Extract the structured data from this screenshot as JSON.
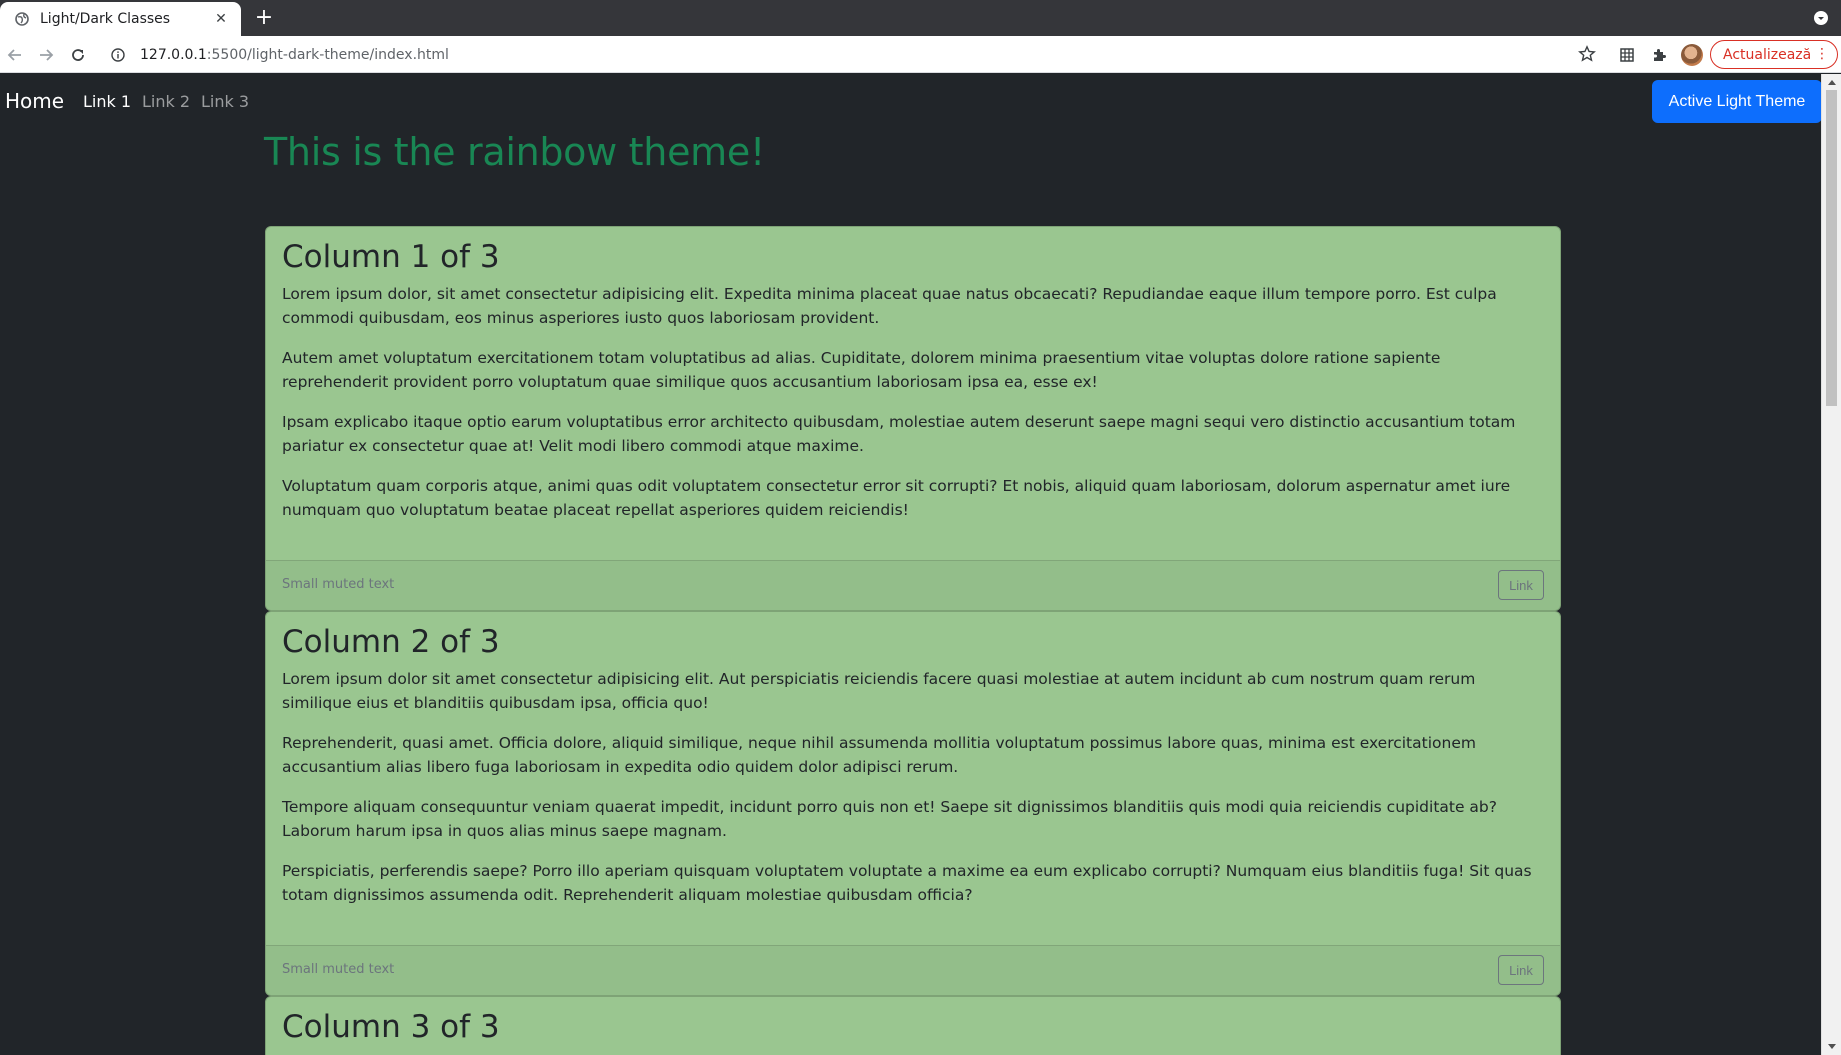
{
  "browser": {
    "tab_title": "Light/Dark Classes",
    "tab_close": "✕",
    "new_tab": "+",
    "url_host": "127.0.0.1",
    "url_rest": ":5500/light-dark-theme/index.html",
    "update_label": "Actualizează",
    "menu_dots": "⋮"
  },
  "navbar": {
    "brand": "Home",
    "links": [
      "Link 1",
      "Link 2",
      "Link 3"
    ],
    "active_link": "Link 1",
    "theme_button": "Active Light Theme"
  },
  "hero": {
    "title": "This is the rainbow theme!"
  },
  "cards": [
    {
      "title": "Column 1 of 3",
      "paragraphs": [
        "Lorem ipsum dolor, sit amet consectetur adipisicing elit. Expedita minima placeat quae natus obcaecati? Repudiandae eaque illum tempore porro. Est culpa commodi quibusdam, eos minus asperiores iusto quos laboriosam provident.",
        "Autem amet voluptatum exercitationem totam voluptatibus ad alias. Cupiditate, dolorem minima praesentium vitae voluptas dolore ratione sapiente reprehenderit provident porro voluptatum quae similique quos accusantium laboriosam ipsa ea, esse ex!",
        "Ipsam explicabo itaque optio earum voluptatibus error architecto quibusdam, molestiae autem deserunt saepe magni sequi vero distinctio accusantium totam pariatur ex consectetur quae at! Velit modi libero commodi atque maxime.",
        "Voluptatum quam corporis atque, animi quas odit voluptatem consectetur error sit corrupti? Et nobis, aliquid quam laboriosam, dolorum aspernatur amet iure numquam quo voluptatum beatae placeat repellat asperiores quidem reiciendis!"
      ],
      "footer_text": "Small muted text",
      "footer_link": "Link"
    },
    {
      "title": "Column 2 of 3",
      "paragraphs": [
        "Lorem ipsum dolor sit amet consectetur adipisicing elit. Aut perspiciatis reiciendis facere quasi molestiae at autem incidunt ab cum nostrum quam rerum similique eius et blanditiis quibusdam ipsa, officia quo!",
        "Reprehenderit, quasi amet. Officia dolore, aliquid similique, neque nihil assumenda mollitia voluptatum possimus labore quas, minima est exercitationem accusantium alias libero fuga laboriosam in expedita odio quidem dolor adipisci rerum.",
        "Tempore aliquam consequuntur veniam quaerat impedit, incidunt porro quis non et! Saepe sit dignissimos blanditiis quis modi quia reiciendis cupiditate ab? Laborum harum ipsa in quos alias minus saepe magnam.",
        "Perspiciatis, perferendis saepe? Porro illo aperiam quisquam voluptatem voluptate a maxime ea eum explicabo corrupti? Numquam eius blanditiis fuga! Sit quas totam dignissimos assumenda odit. Reprehenderit aliquam molestiae quibusdam officia?"
      ],
      "footer_text": "Small muted text",
      "footer_link": "Link"
    },
    {
      "title": "Column 3 of 3"
    }
  ],
  "colors": {
    "page_bg": "#212529",
    "card_bg": "#9ac690",
    "hero_text": "#198754",
    "primary_button": "#0d6efd",
    "muted": "#6c757d",
    "update_accent": "#d93025"
  },
  "icons": {
    "favicon": "globe-icon",
    "back": "arrow-left-icon",
    "forward": "arrow-right-icon",
    "reload": "reload-icon",
    "site_info": "info-icon",
    "bookmark": "star-icon",
    "extension_1": "grid-icon",
    "extension_2": "puzzle-icon",
    "profile": "avatar",
    "tab_list": "chevron-down-icon"
  }
}
